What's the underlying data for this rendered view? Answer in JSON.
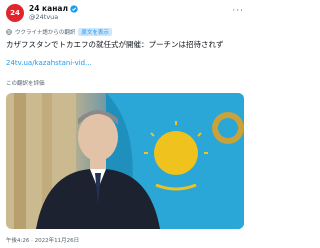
{
  "account": {
    "display_name": "24 канал",
    "handle": "@24tvua",
    "avatar_text": "24"
  },
  "translation": {
    "label": "ウクライナ語からの翻訳",
    "show_original": "原文を表示"
  },
  "tweet": {
    "text": "カザフスタンでトカエフの就任式が開催：プーチンは招待されず",
    "link": "24tv.ua/kazahstani-vid...",
    "rate_translation": "この翻訳を評価",
    "timestamp": "午後4:26 · 2022年11月26日"
  },
  "colors": {
    "accent": "#1d9bf0",
    "verified": "#1d9bf0",
    "avatar_bg": "#e0262c",
    "flag_blue": "#2aa7d6",
    "flag_gold": "#f0c21e"
  },
  "icons": {
    "verified": "verified-badge-icon",
    "globe": "globe-icon",
    "more": "more-options-icon"
  }
}
